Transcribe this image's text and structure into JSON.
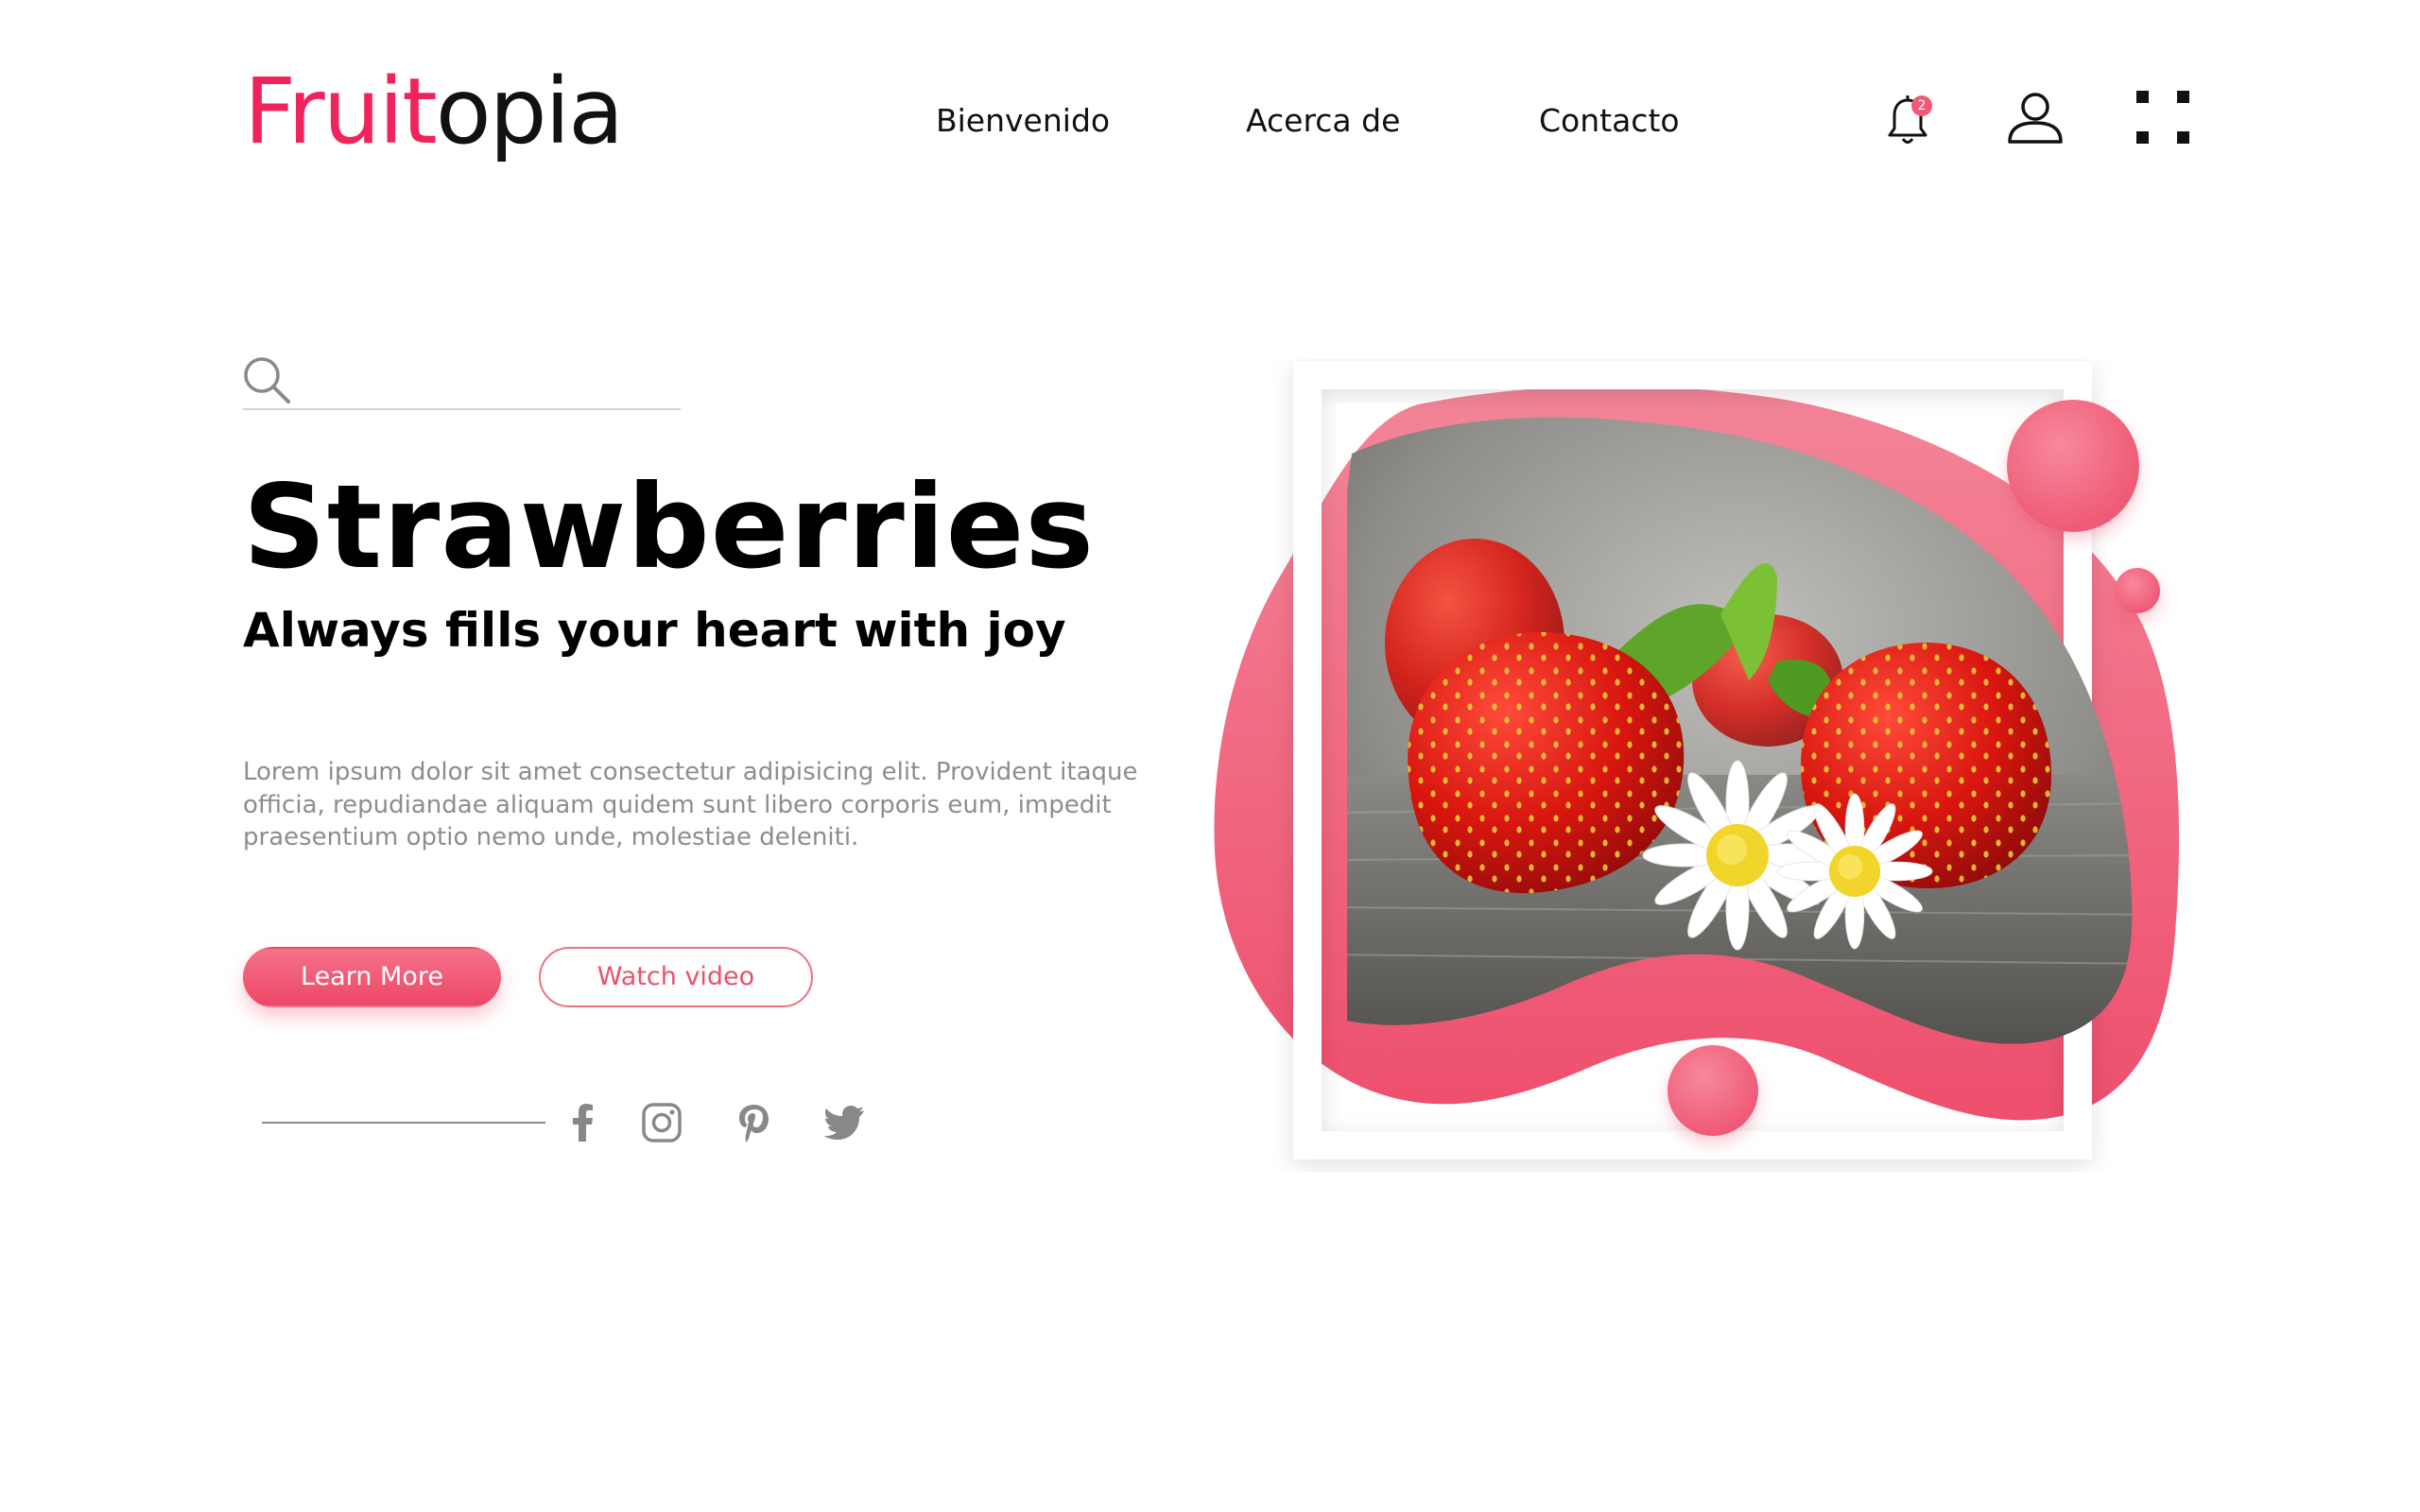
{
  "brand": {
    "logo_accent": "Fruit",
    "logo_rest": "opia",
    "accent_color": "#f0245c"
  },
  "nav": {
    "items": [
      {
        "label": "Bienvenido"
      },
      {
        "label": "Acerca de"
      },
      {
        "label": "Contacto"
      }
    ]
  },
  "header_icons": {
    "notification_badge": "2",
    "icons": [
      "bell-icon",
      "user-icon",
      "grid-menu-icon"
    ]
  },
  "search": {
    "placeholder": "",
    "icon": "search-icon"
  },
  "hero": {
    "title": "Strawberries",
    "subtitle": "Always fills your heart with joy",
    "description": "Lorem ipsum dolor sit amet consectetur adipisicing elit. Provident itaque officia, repudiandae aliquam quidem sunt libero corporis eum, impedit praesentium optio nemo unde, molestiae deleniti.",
    "primary_button": "Learn More",
    "secondary_button": "Watch video",
    "image_alt": "Strawberries with daisies on a wooden table"
  },
  "social": {
    "icons": [
      "facebook-icon",
      "instagram-icon",
      "pinterest-icon",
      "twitter-icon"
    ]
  },
  "colors": {
    "primary": "#ef5b77",
    "secondary_border": "#f07087",
    "text_muted": "#8d8d8d"
  }
}
